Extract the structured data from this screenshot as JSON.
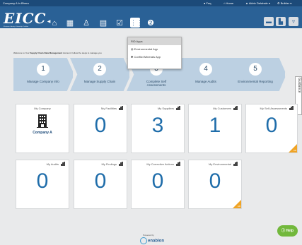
{
  "topbar": {
    "company": "Company A In Bhera",
    "faq": "Faq",
    "home": "Home",
    "user": "Aldric Delahale",
    "role": "Builder"
  },
  "header": {
    "logo": "EICC",
    "logo_tag": "Electronic Industry Citizenship Coalition",
    "icons": [
      "home-icon",
      "building-icon",
      "org-chart-icon",
      "document-icon",
      "checkbox-icon",
      "apps-grid-icon",
      "help-icon"
    ],
    "right_icons": [
      "message-icon",
      "chart-icon",
      "cart-icon"
    ]
  },
  "apps_menu": {
    "items": [
      "RiD Apps",
      "Environmental App",
      "Conflict Minerals App"
    ]
  },
  "welcome": {
    "prefix": "Welcome to Your ",
    "bold": "Supply Chain Data Management",
    "suffix": " Account. Follow the steps to manage you"
  },
  "steps": [
    {
      "num": "1",
      "label": "Manage Company Info"
    },
    {
      "num": "2",
      "label": "Manage Supply Chain"
    },
    {
      "num": "3",
      "label": "Complete Self Assessments"
    },
    {
      "num": "4",
      "label": "Manage Audits"
    },
    {
      "num": "5",
      "label": "Environmental Reporting"
    }
  ],
  "guidance": "Guidance",
  "tiles_row1": [
    {
      "title": "My Company",
      "company_name": "Company A"
    },
    {
      "title": "My Facilities",
      "value": "0"
    },
    {
      "title": "My Suppliers",
      "value": "3"
    },
    {
      "title": "My Customers",
      "value": "1"
    },
    {
      "title": "My Self-Assessments",
      "value": "0",
      "corner": "AD"
    }
  ],
  "tiles_row2": [
    {
      "title": "My Audits",
      "value": "0"
    },
    {
      "title": "My Findings",
      "value": "0"
    },
    {
      "title": "My Corrective Actions",
      "value": "0"
    },
    {
      "title": "My Environmental",
      "value": "0",
      "corner": "AD"
    }
  ],
  "footer": {
    "powered_by": "Powered by",
    "brand": "enablon"
  },
  "help": "Help",
  "colors": {
    "topbar": "#1c4a79",
    "navbar": "#2a6196",
    "step_bg": "#bcd0e2",
    "number": "#1f6daa",
    "corner": "#f0a425",
    "help": "#72b83c"
  }
}
